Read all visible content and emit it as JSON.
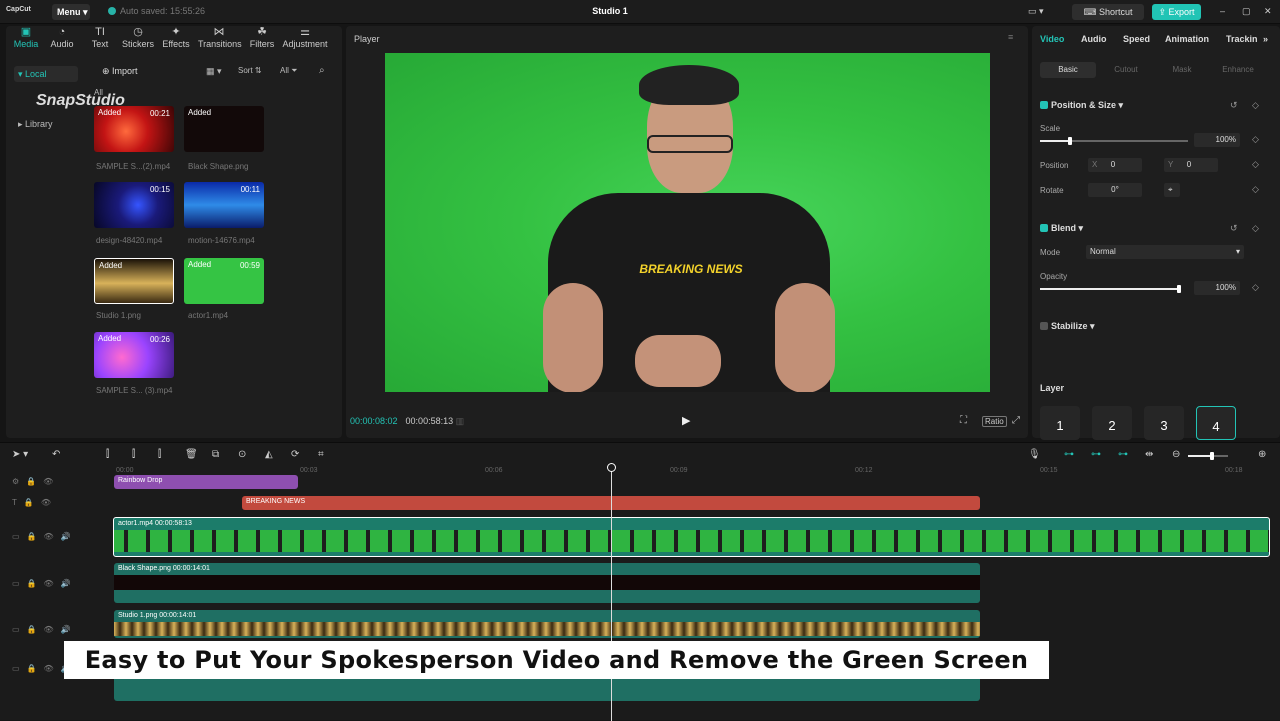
{
  "app": {
    "logo": "CapCut",
    "menu": "Menu",
    "autosave": "Auto saved: 15:55:26",
    "project_title": "Studio 1",
    "shortcut": "Shortcut",
    "export": "Export"
  },
  "media_tabs": [
    "Media",
    "Audio",
    "Text",
    "Stickers",
    "Effects",
    "Transitions",
    "Filters",
    "Adjustment"
  ],
  "media_side": {
    "local": "Local",
    "import": "Import",
    "library": "Library",
    "all_label": "All",
    "sort": "Sort",
    "filter_all": "All"
  },
  "media_items": [
    {
      "name": "SAMPLE S...(2).mp4",
      "added": "Added",
      "duration": "00:21"
    },
    {
      "name": "Black Shape.png",
      "added": "Added",
      "duration": ""
    },
    {
      "name": "design-48420.mp4",
      "added": "",
      "duration": "00:15"
    },
    {
      "name": "motion-14676.mp4",
      "added": "",
      "duration": "00:11"
    },
    {
      "name": "Studio 1.png",
      "added": "Added",
      "duration": ""
    },
    {
      "name": "actor1.mp4",
      "added": "Added",
      "duration": "00:59"
    },
    {
      "name": "SAMPLE S... (3).mp4",
      "added": "Added",
      "duration": "00:26"
    }
  ],
  "watermark": "SnapStudio",
  "player": {
    "label": "Player",
    "current": "00:00:08:02",
    "total": "00:00:58:13",
    "ratio": "Ratio",
    "shirt_text": "BREAKING NEWS"
  },
  "props": {
    "tabs": [
      "Video",
      "Audio",
      "Speed",
      "Animation",
      "Trackin"
    ],
    "subtabs": [
      "Basic",
      "Cutout",
      "Mask",
      "Enhance"
    ],
    "position_size": "Position & Size",
    "scale_label": "Scale",
    "scale_value": "100%",
    "position_label": "Position",
    "pos_x_label": "X",
    "pos_x": "0",
    "pos_y_label": "Y",
    "pos_y": "0",
    "rotate_label": "Rotate",
    "rotate_value": "0°",
    "blend": "Blend",
    "mode_label": "Mode",
    "mode_value": "Normal",
    "opacity_label": "Opacity",
    "opacity_value": "100%",
    "stabilize": "Stabilize",
    "layer_label": "Layer",
    "layers": [
      "1",
      "2",
      "3",
      "4"
    ]
  },
  "timeline": {
    "ruler": [
      "00:00",
      "00:03",
      "00:06",
      "00:09",
      "00:12",
      "00:15",
      "00:18"
    ],
    "clips": {
      "effect": "Rainbow Drop",
      "text": "BREAKING NEWS",
      "main": "actor1.mp4  00:00:58:13",
      "black": "Black Shape.png  00:00:14:01",
      "studio": "Studio 1.png  00:00:14:01"
    }
  },
  "caption": "Easy to Put Your Spokesperson Video and Remove the Green Screen"
}
